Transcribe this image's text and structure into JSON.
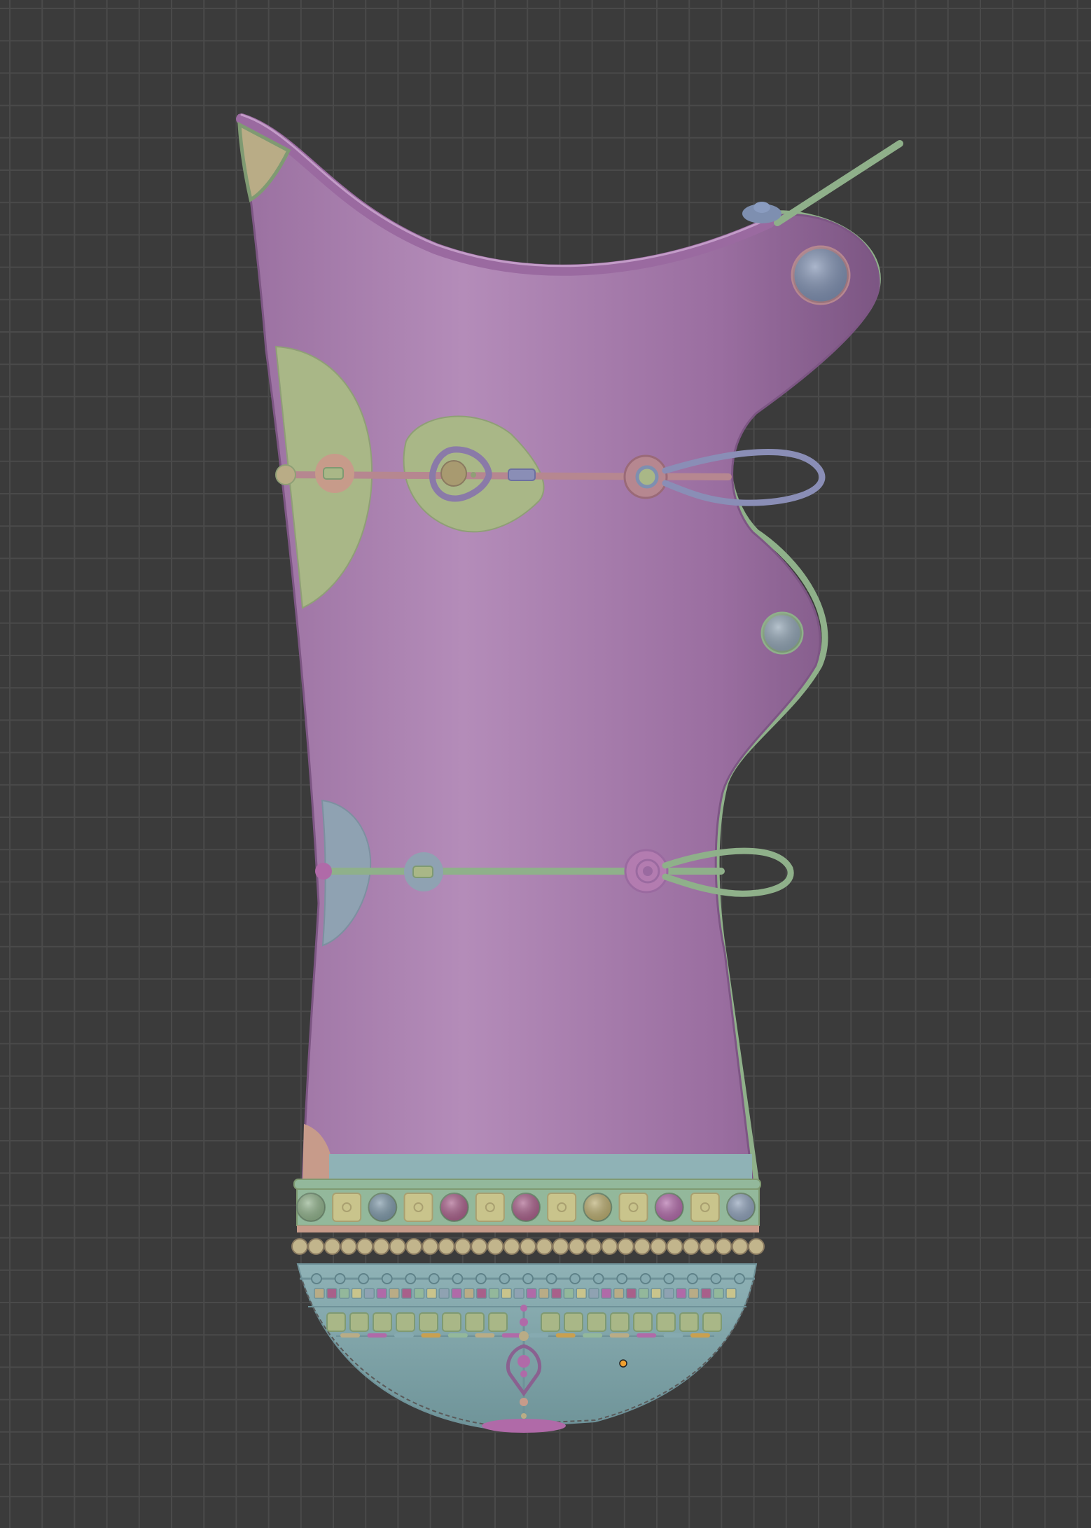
{
  "viewport": {
    "background": "#3b3b3b",
    "grid_color": "#4a4a4a",
    "grid_major_color": "#525252"
  },
  "model": {
    "colors": {
      "body": "#a27aa8",
      "body_dark": "#8a6190",
      "body_light": "#b58dba",
      "rim": "#9a6aa0",
      "green": "#a9b787",
      "green_dark": "#7f9a72",
      "strap_green": "#8fb08a",
      "strap_red": "#b68790",
      "blue_loop": "#8a8eb6",
      "blue": "#8fa2b2",
      "teal": "#86aab0",
      "teal_dark": "#6f9299",
      "mint": "#93b89b",
      "tan": "#b9ac86",
      "peach": "#c79b8a",
      "slate": "#7e8fb0",
      "magenta": "#a8608a",
      "origin": "#f0a030"
    },
    "band_gem_colors": [
      "#8fb08a",
      "#c9c48c",
      "#7e98a8",
      "#c9c48c",
      "#a8608a",
      "#c9c48c",
      "#a8608a",
      "#c9c48c",
      "#b9ac70",
      "#c9c48c",
      "#b06aa8",
      "#c9c48c",
      "#8ea0b8"
    ],
    "small_tile_colors": [
      "#b9ac86",
      "#a8608a",
      "#93b89b",
      "#c9c48c",
      "#8fa2b2",
      "#b06aa8"
    ]
  }
}
